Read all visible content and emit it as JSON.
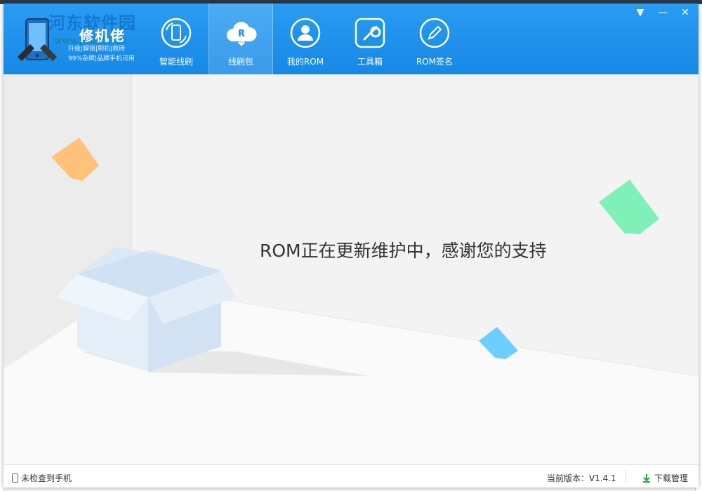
{
  "window": {
    "app_title": "修机佬",
    "app_tagline_1": "升级|解锁|刷机|救砖",
    "app_tagline_2": "99%杂牌|品牌手机可用",
    "watermark": "河东软件园",
    "watermark_url": "www.pc0359.cn"
  },
  "nav": {
    "items": [
      {
        "label": "智能线刷",
        "icon": "phone-refresh-icon",
        "active": false
      },
      {
        "label": "线刷包",
        "icon": "cloud-download-icon",
        "active": true
      },
      {
        "label": "我的ROM",
        "icon": "user-icon",
        "active": false
      },
      {
        "label": "工具箱",
        "icon": "wrench-icon",
        "active": false
      },
      {
        "label": "ROM签名",
        "icon": "pen-icon",
        "active": false
      }
    ]
  },
  "window_controls": {
    "menu": "▼",
    "minimize": "—",
    "close": "✕"
  },
  "content": {
    "message": "ROM正在更新维护中，感谢您的支持"
  },
  "footer": {
    "phone_status": "未检查到手机",
    "version_label": "当前版本：V1.4.1",
    "download_label": "下载管理"
  },
  "colors": {
    "header": "#1a8ceb",
    "accent_green": "#2aa84a",
    "paper_orange": "#ffc27a",
    "paper_green": "#7ff0b8",
    "paper_blue": "#6ccfff"
  }
}
